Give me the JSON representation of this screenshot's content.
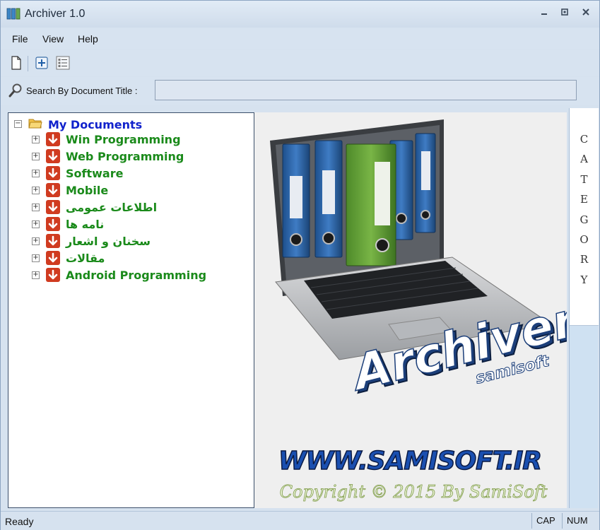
{
  "window": {
    "title": "Archiver 1.0"
  },
  "menu": {
    "items": [
      "File",
      "View",
      "Help"
    ]
  },
  "toolbar": {
    "buttons": [
      "new-document",
      "add",
      "properties"
    ]
  },
  "search": {
    "label": "Search By Document Title :",
    "value": ""
  },
  "tree": {
    "root": "My Documents",
    "categories": [
      "Win Programming",
      "Web Programming",
      "Software",
      "Mobile",
      "اطلاعات عمومی",
      "نامه ها",
      "سخنان و اشعار",
      "مقالات",
      "Android Programming"
    ]
  },
  "splash": {
    "logo_text": "Archiver",
    "logo_subtext": "samisoft",
    "website": "WWW.SAMISOFT.IR",
    "copyright": "Copyright © 2015 By SamiSoft"
  },
  "side_panel": {
    "tab_label": "CATEGORY"
  },
  "statusbar": {
    "status": "Ready",
    "cap": "CAP",
    "num": "NUM"
  },
  "colors": {
    "root_label": "#1122cc",
    "category_label": "#1a8a1a",
    "category_icon": "#d03b20"
  }
}
